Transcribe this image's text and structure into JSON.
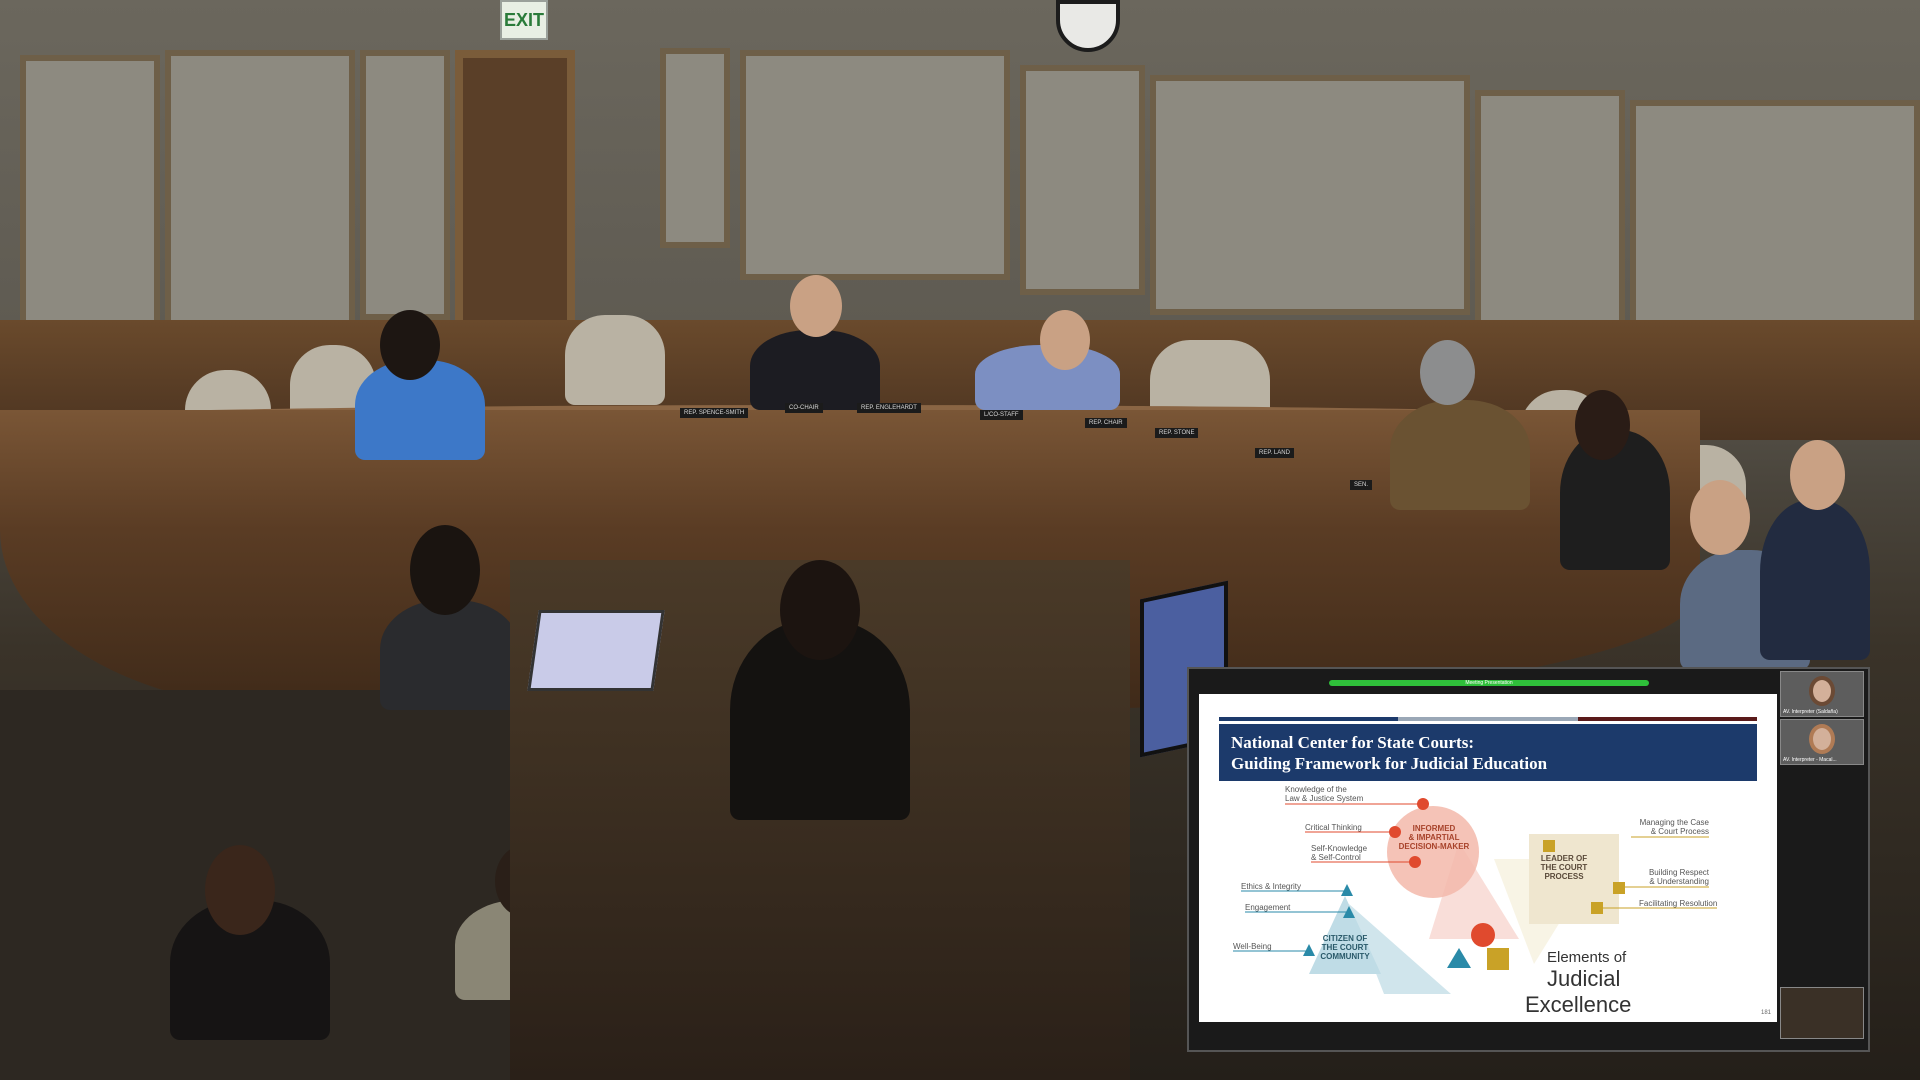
{
  "room": {
    "exit_sign": "EXIT",
    "nameplates": [
      "REP. SPENCE-SMITH",
      "CO-CHAIR",
      "REP. ENGLEHARDT",
      "L/CO-STAFF",
      "REP. CHAIR",
      "REP. STONE",
      "REP. LAND",
      "SEN."
    ]
  },
  "presentation": {
    "slide_top_caption": "Meeting Presentation",
    "title_line1": "National Center for State Courts:",
    "title_line2": "Guiding Framework for Judicial Education",
    "labels": {
      "knowledge": "Knowledge of the\nLaw & Justice System",
      "critical": "Critical Thinking",
      "self": "Self-Knowledge\n& Self-Control",
      "ethics": "Ethics & Integrity",
      "engagement": "Engagement",
      "wellbeing": "Well-Being",
      "managing": "Managing the Case\n& Court Process",
      "respect": "Building Respect\n& Understanding",
      "facilitating": "Facilitating Resolution"
    },
    "centers": {
      "decision": "INFORMED\n& IMPARTIAL\nDECISION-MAKER",
      "leader": "LEADER OF\nTHE COURT\nPROCESS",
      "citizen": "CITIZEN OF\nTHE COURT\nCOMMUNITY"
    },
    "elements_line1": "Elements of",
    "elements_line2": "Judicial",
    "elements_line3": "Excellence",
    "page_number": "181",
    "colors": {
      "header": "#1c3a6b",
      "red": "#e04a2e",
      "gold": "#c9a227",
      "teal": "#2a8aa8"
    }
  },
  "participants": [
    {
      "caption": "AV. Interpreter (Saldaña)"
    },
    {
      "caption": "AV. Interpreter - Macal..."
    }
  ]
}
